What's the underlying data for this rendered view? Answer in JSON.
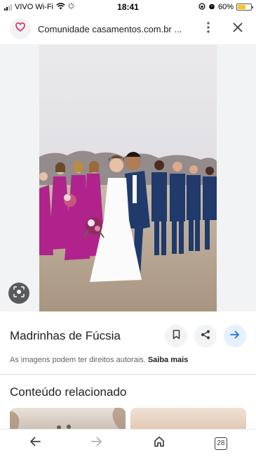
{
  "status_bar": {
    "carrier": "VIVO Wi-Fi",
    "time": "18:41",
    "battery_percent": "60%",
    "battery_level": 0.6
  },
  "browser": {
    "title": "Comunidade casamentos.com.br ...",
    "favicon_icon": "heart-icon",
    "favicon_color": "#e0245e"
  },
  "image_view": {
    "title": "Madrinhas de Fúcsia",
    "rights_text": "As imagens podem ter direitos autorais.",
    "rights_more": "Saiba mais"
  },
  "related": {
    "title": "Conteúdo relacionado"
  },
  "toolbar": {
    "tab_count": "28"
  },
  "colors": {
    "accent_blue": "#1a73e8",
    "fuchsia_dress": "#b0238c",
    "navy_suit": "#1f3a6b"
  }
}
